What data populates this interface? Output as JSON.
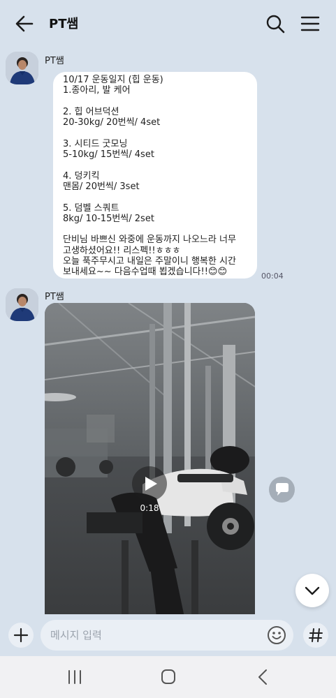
{
  "header": {
    "title": "PT쌤"
  },
  "messages": [
    {
      "sender": "PT쌤",
      "text": "10/17 운동일지 (힙 운동)\n1.종아리, 발 케어\n\n2. 힙 어브덕션\n20-30kg/ 20번씩/ 4set\n\n3. 시티드 굿모닝\n5-10kg/ 15번씩/ 4set\n\n4. 덩키킥\n맨몸/ 20번씩/ 3set\n\n5. 덤벨 스쿼트\n8kg/ 10-15번씩/ 2set\n\n단비님 바쁘신 와중에 운동까지 나오느라 너무\n고생하셨어요!! 리스펙!!ㅎㅎㅎ\n오늘 푹주무시고 내일은 주말이니 행복한 시간\n보내세요~~ 다음수업때 뵙겠습니다!!😊😊",
      "time": "00:04"
    },
    {
      "sender": "PT쌤",
      "video_duration": "0:18"
    }
  ],
  "input": {
    "placeholder": "메시지 입력",
    "value": ""
  },
  "icons": {
    "back": "arrow-left-icon",
    "search": "search-icon",
    "menu": "hamburger-menu-icon",
    "play": "play-icon",
    "chat": "chat-bubble-icon",
    "scroll_down": "chevron-down-icon",
    "plus": "plus-icon",
    "emoji": "emoji-icon",
    "hash": "hashtag-icon",
    "nav_recent": "recent-apps-icon",
    "nav_home": "home-icon",
    "nav_back": "nav-back-icon"
  }
}
